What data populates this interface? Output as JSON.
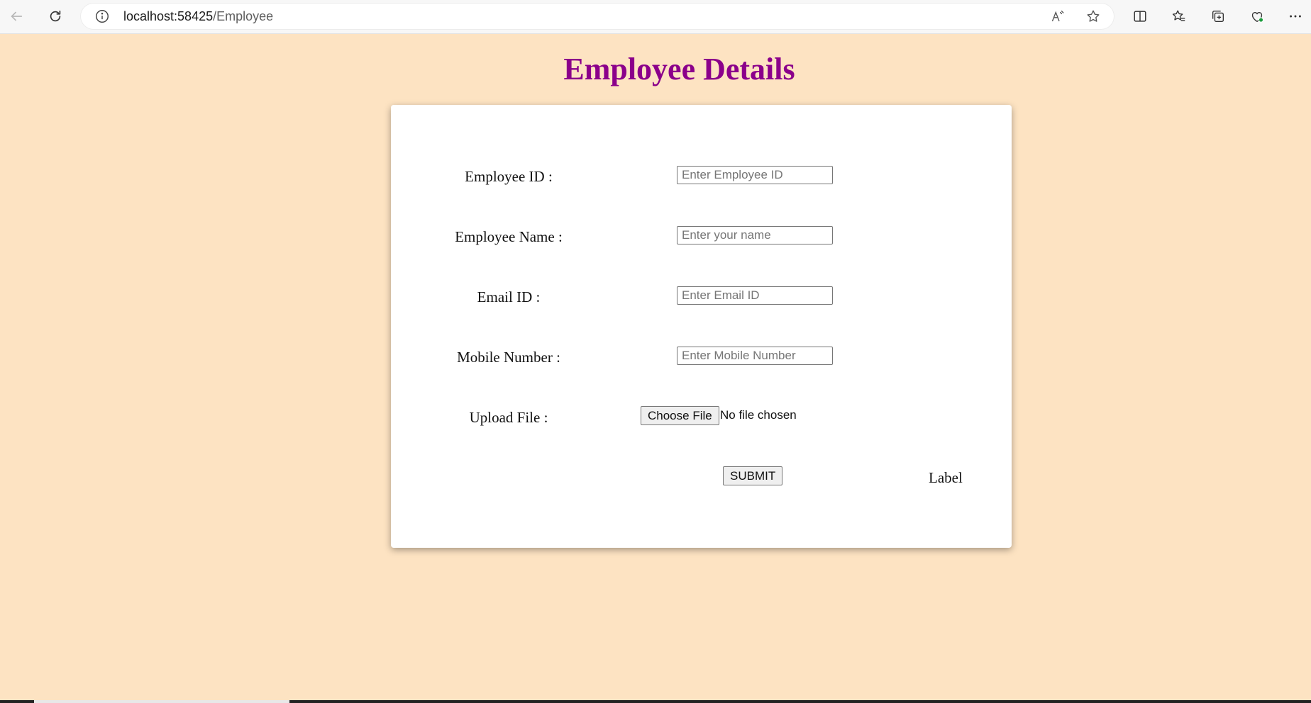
{
  "browser": {
    "url_host": "localhost:58425",
    "url_path": "/Employee",
    "icons": [
      "back-icon",
      "refresh-icon",
      "info-icon",
      "read-aloud-icon",
      "favorite-star-icon",
      "split-screen-icon",
      "favorites-icon",
      "collections-icon",
      "browser-essentials-icon",
      "more-icon"
    ]
  },
  "page": {
    "title": "Employee Details"
  },
  "form": {
    "employee_id": {
      "label": "Employee ID :",
      "placeholder": "Enter Employee ID",
      "value": ""
    },
    "employee_name": {
      "label": "Employee Name :",
      "placeholder": "Enter your name",
      "value": ""
    },
    "email_id": {
      "label": "Email ID :",
      "placeholder": "Enter Email ID",
      "value": ""
    },
    "mobile_number": {
      "label": "Mobile Number :",
      "placeholder": "Enter Mobile Number",
      "value": ""
    },
    "upload_file": {
      "label": "Upload File :",
      "button_label": "Choose File",
      "status": "No file chosen"
    },
    "submit_label": "SUBMIT",
    "result_label": "Label"
  },
  "colors": {
    "page_background": "#fde3c2",
    "title": "#8b008b",
    "card": "#ffffff"
  }
}
